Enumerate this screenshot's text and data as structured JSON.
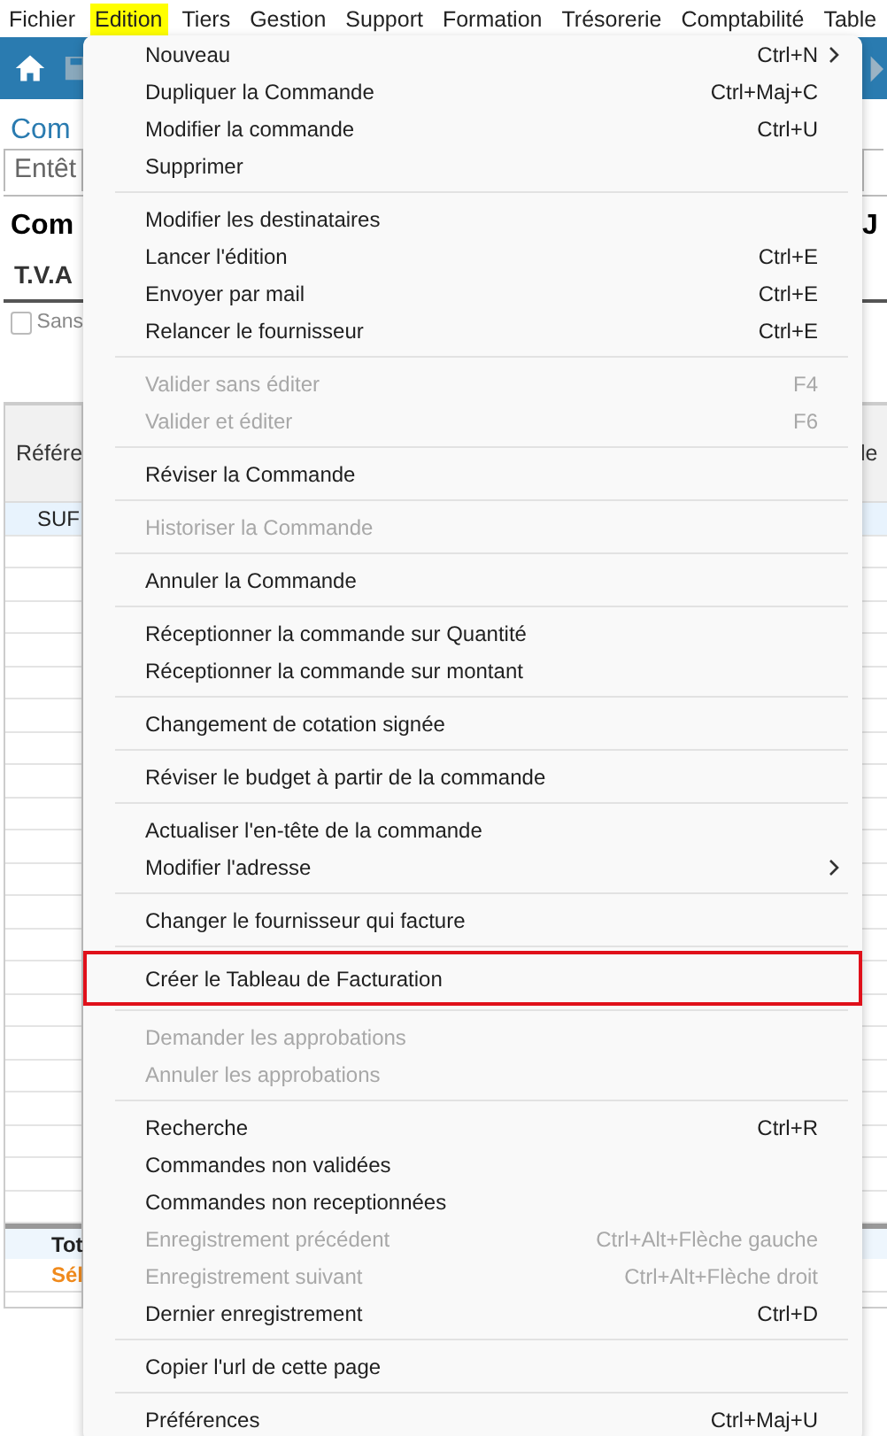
{
  "menu_bar": [
    {
      "label": "Fichier",
      "selected": false
    },
    {
      "label": "Edition",
      "selected": true
    },
    {
      "label": "Tiers",
      "selected": false
    },
    {
      "label": "Gestion",
      "selected": false
    },
    {
      "label": "Support",
      "selected": false
    },
    {
      "label": "Formation",
      "selected": false
    },
    {
      "label": "Trésorerie",
      "selected": false
    },
    {
      "label": "Comptabilité",
      "selected": false
    },
    {
      "label": "Table",
      "selected": false
    }
  ],
  "background": {
    "page_title": "Com",
    "tab": "Entêt",
    "heading": "Com",
    "right_heading": "J",
    "section": "T.V.A",
    "checkbox": {
      "label": "Sans",
      "checked": false
    },
    "table": {
      "column_1": "Référe",
      "column_2": "le",
      "rows": [
        {
          "cell": "SUF",
          "selected": true
        }
      ],
      "total": "Tot",
      "selection": "Sél"
    }
  },
  "dropdown": {
    "groups": [
      [
        {
          "label": "Nouveau",
          "shortcut": "Ctrl+N",
          "disabled": false,
          "submenu": true,
          "highlighted": false
        },
        {
          "label": "Dupliquer la Commande",
          "shortcut": "Ctrl+Maj+C",
          "disabled": false,
          "submenu": false,
          "highlighted": false
        },
        {
          "label": "Modifier la commande",
          "shortcut": "Ctrl+U",
          "disabled": false,
          "submenu": false,
          "highlighted": false
        },
        {
          "label": "Supprimer",
          "disabled": false,
          "submenu": false,
          "highlighted": false
        }
      ],
      [
        {
          "label": "Modifier les destinataires",
          "disabled": false,
          "submenu": false,
          "highlighted": false
        },
        {
          "label": "Lancer l'édition",
          "shortcut": "Ctrl+E",
          "disabled": false,
          "submenu": false,
          "highlighted": false
        },
        {
          "label": "Envoyer par mail",
          "shortcut": "Ctrl+E",
          "disabled": false,
          "submenu": false,
          "highlighted": false
        },
        {
          "label": "Relancer le fournisseur",
          "shortcut": "Ctrl+E",
          "disabled": false,
          "submenu": false,
          "highlighted": false
        }
      ],
      [
        {
          "label": "Valider sans éditer",
          "shortcut": "F4",
          "disabled": true,
          "submenu": false,
          "highlighted": false
        },
        {
          "label": "Valider et éditer",
          "shortcut": "F6",
          "disabled": true,
          "submenu": false,
          "highlighted": false
        }
      ],
      [
        {
          "label": "Réviser la Commande",
          "disabled": false,
          "submenu": false,
          "highlighted": false
        }
      ],
      [
        {
          "label": "Historiser la Commande",
          "disabled": true,
          "submenu": false,
          "highlighted": false
        }
      ],
      [
        {
          "label": "Annuler la Commande",
          "disabled": false,
          "submenu": false,
          "highlighted": false
        }
      ],
      [
        {
          "label": "Réceptionner la commande sur Quantité",
          "disabled": false,
          "submenu": false,
          "highlighted": false
        },
        {
          "label": "Réceptionner la commande sur montant",
          "disabled": false,
          "submenu": false,
          "highlighted": false
        }
      ],
      [
        {
          "label": "Changement de cotation signée",
          "disabled": false,
          "submenu": false,
          "highlighted": false
        }
      ],
      [
        {
          "label": "Réviser le budget à partir de la commande",
          "disabled": false,
          "submenu": false,
          "highlighted": false
        }
      ],
      [
        {
          "label": "Actualiser l'en-tête de la commande",
          "disabled": false,
          "submenu": false,
          "highlighted": false
        },
        {
          "label": "Modifier l'adresse",
          "disabled": false,
          "submenu": true,
          "highlighted": false
        }
      ],
      [
        {
          "label": "Changer le fournisseur qui facture",
          "disabled": false,
          "submenu": false,
          "highlighted": false
        }
      ],
      [
        {
          "label": "Créer le Tableau de Facturation",
          "disabled": false,
          "submenu": false,
          "highlighted": true
        }
      ],
      [
        {
          "label": "Demander les approbations",
          "disabled": true,
          "submenu": false,
          "highlighted": false
        },
        {
          "label": "Annuler les approbations",
          "disabled": true,
          "submenu": false,
          "highlighted": false
        }
      ],
      [
        {
          "label": "Recherche",
          "shortcut": "Ctrl+R",
          "disabled": false,
          "submenu": false,
          "highlighted": false
        },
        {
          "label": "Commandes non validées",
          "disabled": false,
          "submenu": false,
          "highlighted": false
        },
        {
          "label": "Commandes non receptionnées",
          "disabled": false,
          "submenu": false,
          "highlighted": false
        },
        {
          "label": "Enregistrement précédent",
          "shortcut": "Ctrl+Alt+Flèche gauche",
          "disabled": true,
          "submenu": false,
          "highlighted": false
        },
        {
          "label": "Enregistrement suivant",
          "shortcut": "Ctrl+Alt+Flèche droit",
          "disabled": true,
          "submenu": false,
          "highlighted": false
        },
        {
          "label": "Dernier enregistrement",
          "shortcut": "Ctrl+D",
          "disabled": false,
          "submenu": false,
          "highlighted": false
        }
      ],
      [
        {
          "label": "Copier l'url de cette page",
          "disabled": false,
          "submenu": false,
          "highlighted": false
        }
      ],
      [
        {
          "label": "Préférences",
          "shortcut": "Ctrl+Maj+U",
          "disabled": false,
          "submenu": false,
          "highlighted": false
        }
      ]
    ]
  }
}
